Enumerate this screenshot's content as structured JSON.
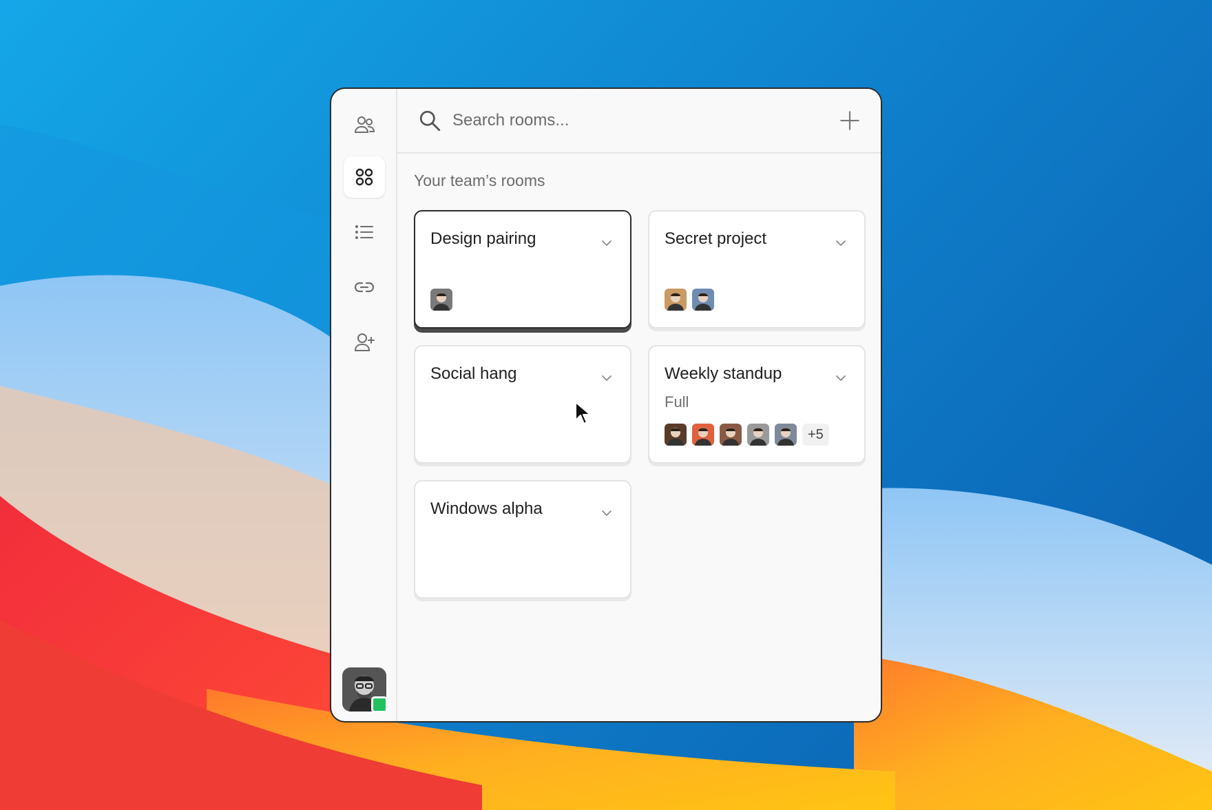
{
  "search": {
    "placeholder": "Search rooms..."
  },
  "section_title": "Your team’s rooms",
  "rooms": [
    {
      "title": "Design pairing",
      "subtitle": "",
      "selected": true,
      "avatars": [
        "#7a7a7a"
      ],
      "more": ""
    },
    {
      "title": "Secret project",
      "subtitle": "",
      "selected": false,
      "avatars": [
        "#c99a62",
        "#6f8cb2"
      ],
      "more": ""
    },
    {
      "title": "Social hang",
      "subtitle": "",
      "selected": false,
      "avatars": [],
      "more": ""
    },
    {
      "title": "Weekly standup",
      "subtitle": "Full",
      "selected": false,
      "avatars": [
        "#5a3b2a",
        "#e0613e",
        "#8b5a44",
        "#9a9a9a",
        "#7e8a9a"
      ],
      "more": "+5"
    },
    {
      "title": "Windows alpha",
      "subtitle": "",
      "selected": false,
      "avatars": [],
      "more": ""
    }
  ],
  "rail": [
    {
      "name": "team-icon",
      "active": false
    },
    {
      "name": "rooms-grid-icon",
      "active": true
    },
    {
      "name": "list-icon",
      "active": false
    },
    {
      "name": "link-icon",
      "active": false
    },
    {
      "name": "add-person-icon",
      "active": false
    }
  ],
  "colors": {
    "presence": "#22c15e",
    "selected_border": "#2b2b2b"
  }
}
